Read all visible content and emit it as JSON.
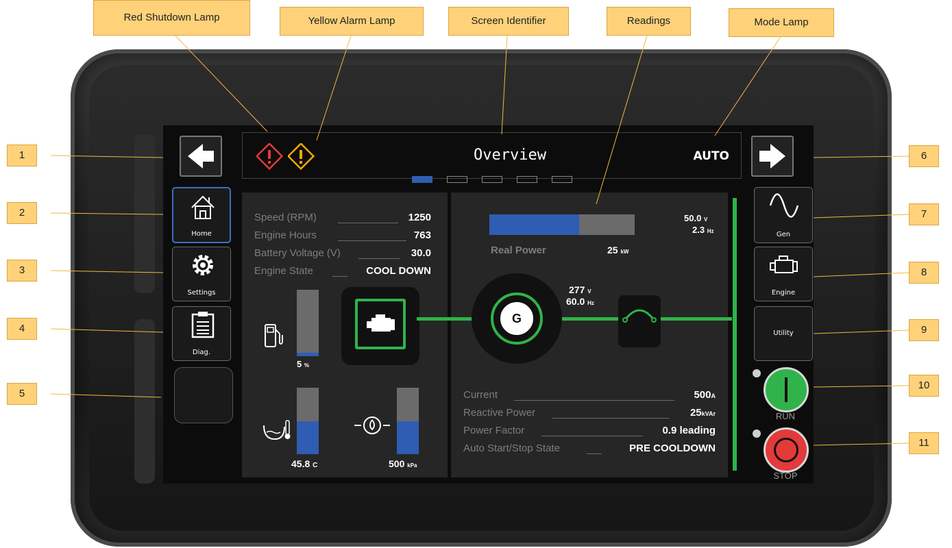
{
  "callouts": {
    "red_shutdown": "Red Shutdown Lamp",
    "yellow_alarm": "Yellow Alarm Lamp",
    "screen_identifier": "Screen Identifier",
    "readings": "Readings",
    "mode_lamp": "Mode Lamp"
  },
  "numbers": [
    "1",
    "2",
    "3",
    "4",
    "5",
    "6",
    "7",
    "8",
    "9",
    "10",
    "11"
  ],
  "header": {
    "title": "Overview",
    "mode": "AUTO",
    "page_count": 5,
    "active_page": 1
  },
  "left_nav": {
    "home": "Home",
    "settings": "Settings",
    "diag": "Diag."
  },
  "right_nav": {
    "gen": "Gen",
    "engine": "Engine",
    "utility": "Utility"
  },
  "controls": {
    "run": "RUN",
    "stop": "STOP"
  },
  "engine_readings": [
    {
      "label": "Speed (RPM)",
      "value": "1250"
    },
    {
      "label": "Engine Hours",
      "value": "763"
    },
    {
      "label": "Battery Voltage (V)",
      "value": "30.0"
    },
    {
      "label": "Engine State",
      "value": "COOL DOWN"
    }
  ],
  "gauges": {
    "fuel": {
      "value": "5",
      "unit": "%",
      "level": 0.05
    },
    "coolant": {
      "value": "45.8",
      "unit": "C",
      "level": 0.5
    },
    "oil": {
      "value": "500",
      "unit": "kPa",
      "level": 0.5
    }
  },
  "power": {
    "real_power_label": "Real Power",
    "real_power_value": "25",
    "real_power_unit": "kW",
    "real_power_fraction": 0.62,
    "gen_voltage": "277",
    "gen_voltage_unit": "V",
    "gen_freq": "60.0",
    "gen_freq_unit": "Hz",
    "bus_voltage": "50.0",
    "bus_voltage_unit": "V",
    "bus_freq": "2.3",
    "bus_freq_unit": "Hz"
  },
  "gen_readings": [
    {
      "label": "Current",
      "value": "500",
      "unit": "A"
    },
    {
      "label": "Reactive Power",
      "value": "25",
      "unit": "kVAr"
    },
    {
      "label": "Power Factor",
      "value": "0.9 leading",
      "unit": ""
    },
    {
      "label": "Auto Start/Stop State",
      "value": "PRE COOLDOWN",
      "unit": ""
    }
  ],
  "icons": {
    "generator": "G"
  },
  "colors": {
    "accent_blue": "#2f5db3",
    "green": "#2fb34a",
    "red": "#e33a3a",
    "yellow": "#f2a900",
    "callout": "#ffd27a"
  }
}
